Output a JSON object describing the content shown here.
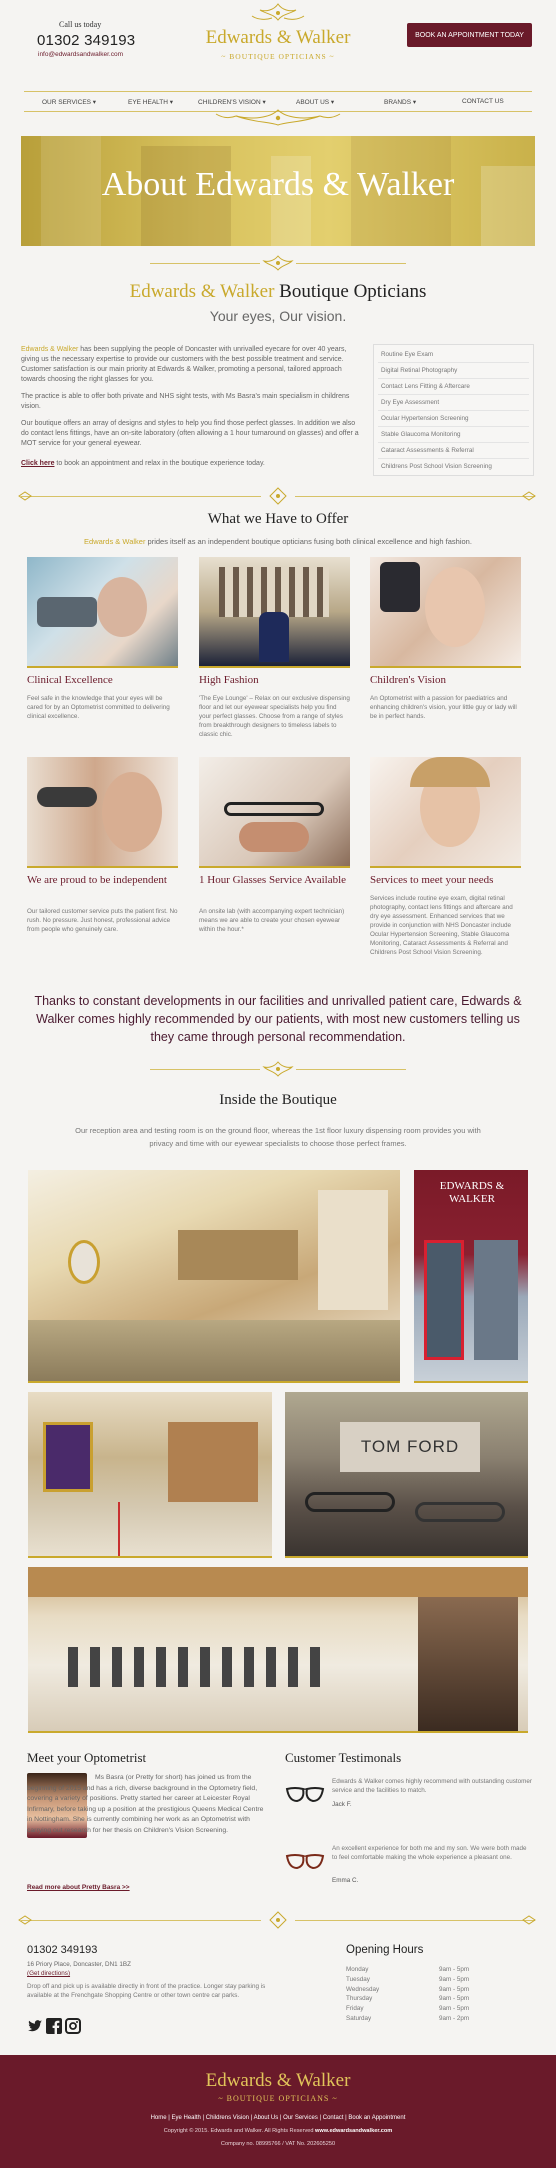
{
  "header": {
    "call_label": "Call us today",
    "phone": "01302 349193",
    "email": "info@edwardsandwalker.com",
    "logo_name": "Edwards & Walker",
    "logo_sub": "~ BOUTIQUE OPTICIANS ~",
    "book_button": "BOOK AN APPOINTMENT TODAY"
  },
  "nav": {
    "items": [
      "OUR SERVICES ▾",
      "EYE HEALTH ▾",
      "CHILDREN'S VISION ▾",
      "ABOUT US ▾",
      "BRANDS ▾",
      "CONTACT US"
    ]
  },
  "hero": {
    "title": "About Edwards & Walker"
  },
  "intro": {
    "title_gold": "Edwards & Walker",
    "title_rest": " Boutique Opticians",
    "subtitle": "Your eyes, Our vision.",
    "p1_gold": "Edwards & Walker",
    "p1_rest": " has been supplying the people of Doncaster with unrivalled eyecare for over 40 years, giving us the necessary expertise to provide our customers with the best possible treatment and service. Customer satisfaction is our main priority at Edwards & Walker, promoting a personal, tailored approach towards choosing the right glasses for you.",
    "p2": "The practice is able to offer both private and NHS sight tests, with Ms Basra's main specialism in childrens vision.",
    "p3": "Our boutique offers an array of designs and styles to help you find those perfect glasses. In addition we also do contact lens fittings, have an on-site laboratory (often allowing a 1 hour turnaround on glasses) and offer a MOT service for your general eyewear.",
    "cta_link": "Click here",
    "cta_rest": " to book an appointment and relax in the boutique experience today."
  },
  "services_list": [
    "Routine Eye Exam",
    "Digital Retinal Photography",
    "Contact Lens Fitting & Aftercare",
    "Dry Eye Assessment",
    "Ocular Hypertension Screening",
    "Stable Glaucoma Monitoring",
    "Cataract Assessments & Referral",
    "Childrens Post School Vision Screening"
  ],
  "offer": {
    "title": "What we Have to Offer",
    "sub_gold": "Edwards & Walker",
    "sub_rest": " prides itself as an independent boutique opticians fusing both clinical excellence and high fashion.",
    "cards": [
      {
        "title": "Clinical Excellence",
        "text": "Feel safe in the knowledge that your eyes will be cared for by an Optometrist committed to delivering clinical excellence."
      },
      {
        "title": "High Fashion",
        "text": "'The Eye Lounge' – Relax on our exclusive dispensing floor and let our eyewear specialists help you find your perfect glasses. Choose from a range of styles from breakthrough designers to timeless labels to classic chic."
      },
      {
        "title": "Children's Vision",
        "text": "An Optometrist with a passion for paediatrics and enhancing children's vision, your little guy or lady will be in perfect hands."
      },
      {
        "title": "We are proud to be independent",
        "text": "Our tailored customer service puts the patient first. No rush. No pressure. Just honest, professional advice from people who genuinely care."
      },
      {
        "title": "1 Hour Glasses Service Available",
        "text": "An onsite lab (with accompanying expert technician) means we are able to create your chosen eyewear within the hour.*"
      },
      {
        "title": "Services to meet your needs",
        "text": "Services include routine eye exam, digital retinal photography, contact lens fittings and aftercare and dry eye assessment. Enhanced services that we provide in conjunction with NHS Doncaster include Ocular Hypertension Screening, Stable Glaucoma Monitoring, Cataract Assessments & Referral and Childrens Post School Vision Screening."
      }
    ]
  },
  "quote": "Thanks to constant developments in our facilities and unrivalled patient care, Edwards & Walker comes highly recommended by our patients, with most new customers telling us they came through personal recommendation.",
  "inside": {
    "title": "Inside the Boutique",
    "text": "Our reception area and testing room is on the ground floor, whereas the 1st floor luxury dispensing room provides you with privacy and time with our eyewear specialists to choose those perfect frames.",
    "sign_text": "EDWARDS & WALKER",
    "brand_sign": "TOM FORD"
  },
  "optometrist": {
    "title": "Meet your Optometrist",
    "text": "Ms Basra (or Pretty for short) has joined us from the beginning of 2015 and has a rich, diverse background in the Optometry field, covering a variety of positions. Pretty started her career at Leicester Royal Infirmary, before taking up a position at the prestigious Queens Medical Centre in Nottingham. She is currently combining her work as an Optometrist with carrying out research for her thesis on Children's Vision Screening.",
    "link": "Read more about Pretty Basra >>"
  },
  "testimonials": {
    "title": "Customer Testimonals",
    "items": [
      {
        "text": "Edwards & Walker comes highly recommend with outstanding customer service and the facilities to match.",
        "author": "Jack F."
      },
      {
        "text": "An excellent experience for both me and my son. We were both made to feel comfortable making the whole experience a pleasant one.",
        "author": "Emma C."
      }
    ]
  },
  "contact": {
    "phone": "01302 349193",
    "address": "16 Priory Place, Doncaster, DN1 1BZ",
    "directions": "(Get directions)",
    "note": "Drop off and pick up is available directly in front of the practice. Longer stay parking is available at the Frenchgate Shopping Centre or other town centre car parks."
  },
  "hours": {
    "title": "Opening Hours",
    "rows": [
      {
        "day": "Monday",
        "time": "9am - 5pm"
      },
      {
        "day": "Tuesday",
        "time": "9am - 5pm"
      },
      {
        "day": "Wednesday",
        "time": "9am - 5pm"
      },
      {
        "day": "Thursday",
        "time": "9am - 5pm"
      },
      {
        "day": "Friday",
        "time": "9am - 5pm"
      },
      {
        "day": "Saturday",
        "time": "9am - 2pm"
      }
    ]
  },
  "footer": {
    "name": "Edwards & Walker",
    "sub": "~ BOUTIQUE OPTICIANS ~",
    "links": [
      "Home",
      "Eye Health",
      "Childrens Vision",
      "About Us",
      "Our Services",
      "Contact",
      "Book an Appointment"
    ],
    "copyright": "Copyright © 2015. Edwards and Walker. All Rights Reserved",
    "site": "www.edwardsandwalker.com",
    "company": "Company no. 08995766 / VAT No. 202605250"
  },
  "colors": {
    "gold": "#c9a92c",
    "maroon": "#6a1a2a",
    "background": "#f5f4f2"
  }
}
